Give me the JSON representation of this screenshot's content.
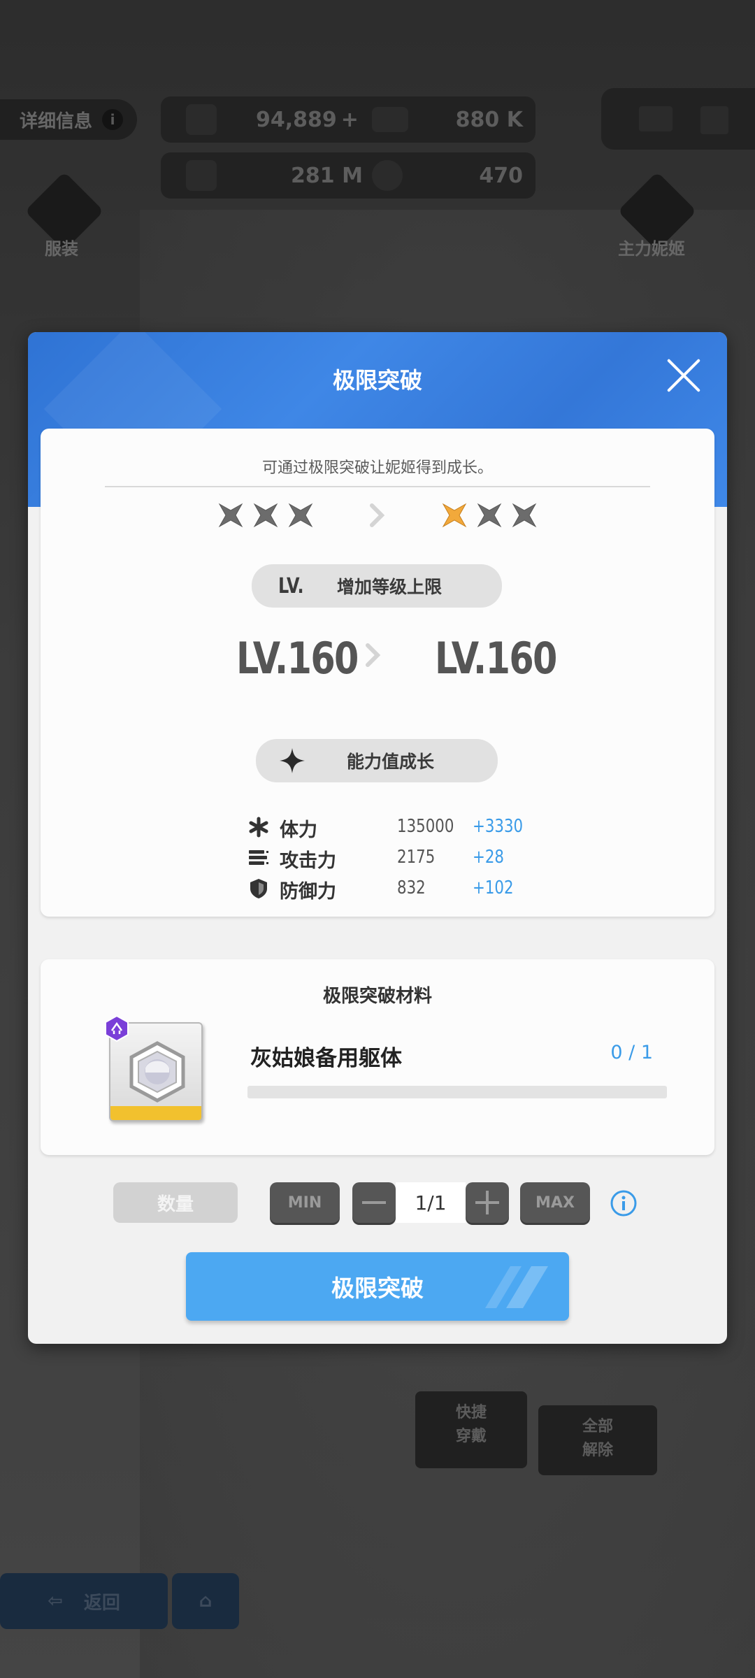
{
  "background": {
    "detail_tab": "详细信息",
    "resources": {
      "gems": "94,889",
      "gems_add": "+",
      "credits": "880 K",
      "battle_data": "281 M",
      "core_dust": "470"
    },
    "costume_label": "服装",
    "main_nikke_label": "主力妮姬",
    "quick_equip_label": "快捷\n穿戴",
    "unequip_all_label": "全部\n解除",
    "back_label": "返回"
  },
  "modal": {
    "title": "极限突破",
    "description": "可通过极限突破让妮姬得到成长。",
    "stars_before": [
      "gray",
      "gray",
      "gray"
    ],
    "stars_after": [
      "gold",
      "gray",
      "gray"
    ],
    "level_section": {
      "prefix": "LV.",
      "label": "增加等级上限",
      "level_before": "LV.160",
      "level_after": "LV.160"
    },
    "stat_section": {
      "label": "能力值成长",
      "stats": [
        {
          "icon": "hp-icon",
          "name": "体力",
          "value": "135000",
          "increase": "+3330"
        },
        {
          "icon": "attack-icon",
          "name": "攻击力",
          "value": "2175",
          "increase": "+28"
        },
        {
          "icon": "defense-icon",
          "name": "防御力",
          "value": "832",
          "increase": "+102"
        }
      ]
    },
    "materials": {
      "title": "极限突破材料",
      "item_name": "灰姑娘备用躯体",
      "count": "0 / 1",
      "progress": 0
    },
    "quantity": {
      "label": "数量",
      "min_label": "MIN",
      "max_label": "MAX",
      "value": "1/1"
    },
    "confirm_label": "极限突破"
  },
  "colors": {
    "header_blue": "#3a80df",
    "accent_blue": "#4ca8f2",
    "increase_blue": "#3a9be8",
    "star_gold": "#f2a93b"
  }
}
